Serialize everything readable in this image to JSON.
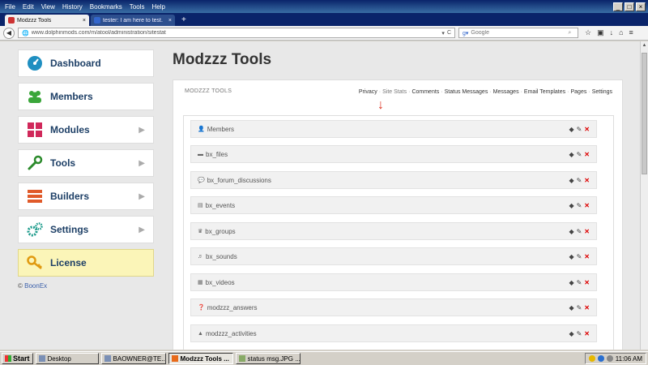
{
  "browser": {
    "menu": [
      "File",
      "Edit",
      "View",
      "History",
      "Bookmarks",
      "Tools",
      "Help"
    ],
    "tabs": [
      {
        "title": "Modzzz Tools",
        "active": true
      },
      {
        "title": "tester: I am here to test.",
        "active": false
      }
    ],
    "url": "www.dolphinmods.com/m/atool/administration/sitestat",
    "search_placeholder": "Google"
  },
  "sidebar": {
    "items": [
      {
        "label": "Dashboard",
        "icon": "dashboard-icon",
        "color": "#1f8fc1"
      },
      {
        "label": "Members",
        "icon": "members-icon",
        "color": "#3aa63a"
      },
      {
        "label": "Modules",
        "icon": "modules-icon",
        "color": "#d0285a"
      },
      {
        "label": "Tools",
        "icon": "wrench-icon",
        "color": "#2b8a2b"
      },
      {
        "label": "Builders",
        "icon": "builders-icon",
        "color": "#e05a2a"
      },
      {
        "label": "Settings",
        "icon": "gears-icon",
        "color": "#1a9a8a"
      },
      {
        "label": "License",
        "icon": "key-icon",
        "color": "#e09a10"
      }
    ],
    "copyright_symbol": "©",
    "copyright_link": "BoonEx"
  },
  "main": {
    "title": "Modzzz Tools",
    "panel_header": "MODZZZ TOOLS",
    "links": [
      "Privacy",
      "Site Stats",
      "Comments",
      "Status Messages",
      "Messages",
      "Email Templates",
      "Pages",
      "Settings"
    ],
    "rows": [
      {
        "label": "Members",
        "icon": "👤"
      },
      {
        "label": "bx_files",
        "icon": "▬"
      },
      {
        "label": "bx_forum_discussions",
        "icon": "💬"
      },
      {
        "label": "bx_events",
        "icon": "▤"
      },
      {
        "label": "bx_groups",
        "icon": "♛"
      },
      {
        "label": "bx_sounds",
        "icon": "♬"
      },
      {
        "label": "bx_videos",
        "icon": "▦"
      },
      {
        "label": "modzzz_answers",
        "icon": "❓"
      },
      {
        "label": "modzzz_activities",
        "icon": "▲"
      }
    ]
  },
  "taskbar": {
    "start": "Start",
    "tasks": [
      {
        "label": "Desktop",
        "active": false
      },
      {
        "label": "BAOWNER@TE...",
        "active": false
      },
      {
        "label": "Modzzz Tools ...",
        "active": true
      },
      {
        "label": "status msg.JPG ...",
        "active": false
      }
    ],
    "clock": "11:06 AM"
  }
}
